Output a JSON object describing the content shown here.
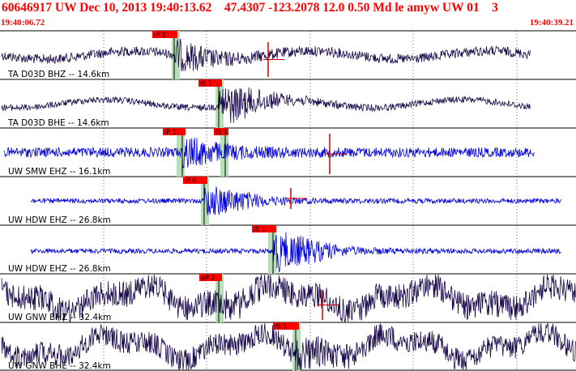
{
  "header": {
    "title": "60646917 UW Dec 10, 2013 19:40:13.62    47.4307 -123.2078 12.0 0.50 Md le amyw UW 01    3",
    "start_time": "19:40:06.72",
    "end_time": "19:40:39.21"
  },
  "colors": {
    "header_red": "#ff0000",
    "trace_dark": "#1a0a4a",
    "trace_blue": "#0000dd",
    "pick_window": "#b8e0b8",
    "pick_flag": "#ff0000"
  },
  "traces": [
    {
      "label": "TA D03D BHZ -- 14.6km",
      "color": "dark",
      "picks": [
        {
          "label": "iP 1"
        }
      ]
    },
    {
      "label": "TA D03D BHE -- 14.6km",
      "color": "dark",
      "picks": [
        {
          "label": "iS 1"
        }
      ]
    },
    {
      "label": "UW SMW EHZ -- 16.1km",
      "color": "blue",
      "picks": [
        {
          "label": "iP 1"
        },
        {
          "label": "iS 1"
        }
      ]
    },
    {
      "label": "UW HDW EHZ -- 26.8km",
      "color": "blue",
      "picks": [
        {
          "label": "iP 0"
        }
      ]
    },
    {
      "label": "UW HDW EHZ -- 26.8km",
      "color": "blue",
      "picks": [
        {
          "label": "iS 1"
        }
      ]
    },
    {
      "label": "UW GNW BHZ -- 32.4km",
      "color": "dark",
      "picks": [
        {
          "label": "eP 2"
        }
      ]
    },
    {
      "label": "UW GNW BHE -- 32.4km",
      "color": "dark",
      "picks": [
        {
          "label": "iS 1"
        }
      ]
    }
  ]
}
